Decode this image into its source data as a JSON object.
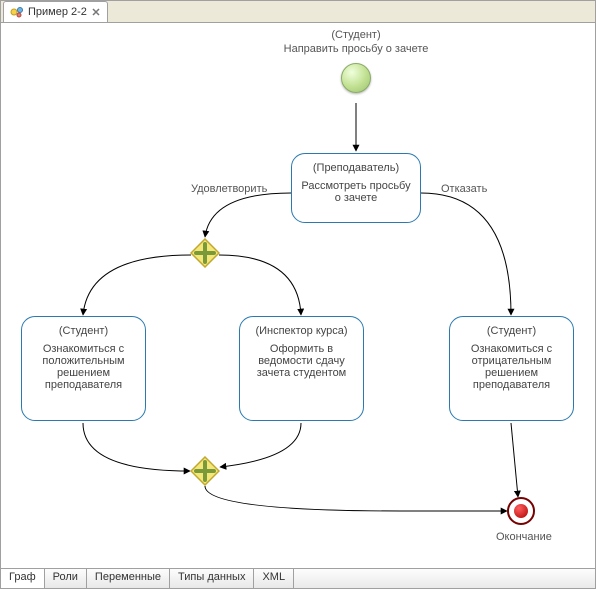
{
  "top_tab": {
    "title": "Пример 2-2"
  },
  "bottom_tabs": [
    "Граф",
    "Роли",
    "Переменные",
    "Типы данных",
    "XML"
  ],
  "start": {
    "role": "(Студент)",
    "label": "Направить просьбу о зачете"
  },
  "task_review": {
    "role": "(Преподаватель)",
    "label": "Рассмотреть просьбу о зачете"
  },
  "task_positive": {
    "role": "(Студент)",
    "label": "Ознакомиться с положительным решением преподавателя"
  },
  "task_form": {
    "role": "(Инспектор курса)",
    "label": "Оформить в ведомости сдачу зачета студентом"
  },
  "task_negative": {
    "role": "(Студент)",
    "label": "Ознакомиться с отрицательным решением преподавателя"
  },
  "edge_accept": "Удовлетворить",
  "edge_reject": "Отказать",
  "end_label": "Окончание",
  "chart_data": {
    "type": "bpmn-flowchart",
    "nodes": [
      {
        "id": "start",
        "type": "start-event",
        "role": "Студент",
        "label": "Направить просьбу о зачете"
      },
      {
        "id": "review",
        "type": "task",
        "role": "Преподаватель",
        "label": "Рассмотреть просьбу о зачете"
      },
      {
        "id": "gw_split",
        "type": "parallel-gateway"
      },
      {
        "id": "positive",
        "type": "task",
        "role": "Студент",
        "label": "Ознакомиться с положительным решением преподавателя"
      },
      {
        "id": "form",
        "type": "task",
        "role": "Инспектор курса",
        "label": "Оформить в ведомости сдачу зачета студентом"
      },
      {
        "id": "negative",
        "type": "task",
        "role": "Студент",
        "label": "Ознакомиться с отрицательным решением преподавателя"
      },
      {
        "id": "gw_join",
        "type": "parallel-gateway"
      },
      {
        "id": "end",
        "type": "end-event",
        "label": "Окончание"
      }
    ],
    "edges": [
      {
        "from": "start",
        "to": "review"
      },
      {
        "from": "review",
        "to": "gw_split",
        "label": "Удовлетворить"
      },
      {
        "from": "review",
        "to": "negative",
        "label": "Отказать"
      },
      {
        "from": "gw_split",
        "to": "positive"
      },
      {
        "from": "gw_split",
        "to": "form"
      },
      {
        "from": "positive",
        "to": "gw_join"
      },
      {
        "from": "form",
        "to": "gw_join"
      },
      {
        "from": "gw_join",
        "to": "end"
      },
      {
        "from": "negative",
        "to": "end"
      }
    ]
  }
}
